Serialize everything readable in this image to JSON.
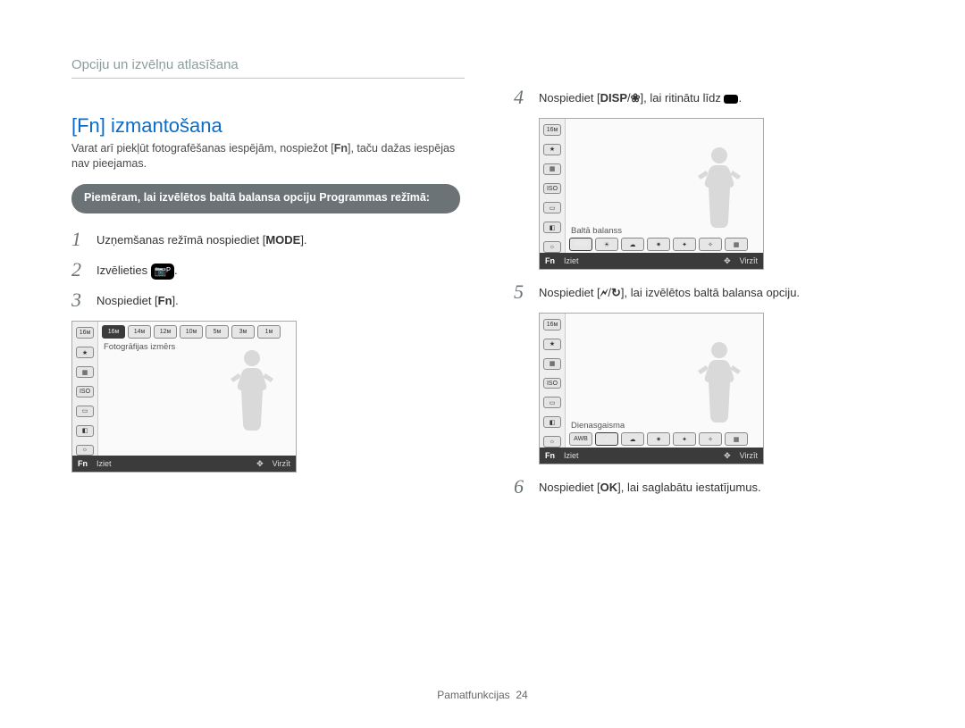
{
  "breadcrumb": "Opciju un izvēlņu atlasīšana",
  "heading": "[Fn] izmantošana",
  "intro_a": "Varat arī piekļūt fotografēšanas iespējām, nospiežot [",
  "intro_b": "], taču dažas iespējas nav pieejamas.",
  "intro_fn": "Fn",
  "pill": "Piemēram, lai izvēlētos baltā balansa opciju Programmas režīmā:",
  "steps": {
    "1": {
      "n": "1",
      "a": "Uzņemšanas režīmā nospiediet [",
      "key": "MODE",
      "b": "]."
    },
    "2": {
      "n": "2",
      "a": "Izvēlieties ",
      "b": "."
    },
    "3": {
      "n": "3",
      "a": "Nospiediet [",
      "key": "Fn",
      "b": "]."
    },
    "4": {
      "n": "4",
      "a": "Nospiediet [",
      "k1": "DISP",
      "sep": "/",
      "k2": "❀",
      "b": "], lai ritinātu līdz ",
      "c": "."
    },
    "5": {
      "n": "5",
      "a": "Nospiediet [",
      "k1": "🗲",
      "sep": "/",
      "k2": "↻",
      "b": "], lai izvēlētos baltā balansa opciju."
    },
    "6": {
      "n": "6",
      "a": "Nospiediet [",
      "key": "OK",
      "b": "], lai saglabātu iestatījumus."
    }
  },
  "lcd1": {
    "label": "Fotogrāfijas izmērs",
    "chips": [
      "16м",
      "14м",
      "12м",
      "10м",
      "5м",
      "3м",
      "1м"
    ],
    "fn": "Fn",
    "exit": "Iziet",
    "nav": "Virzīt"
  },
  "lcd2": {
    "label": "Baltā balanss",
    "fn": "Fn",
    "exit": "Iziet",
    "nav": "Virzīt"
  },
  "lcd3": {
    "label": "Dienasgaisma",
    "fn": "Fn",
    "exit": "Iziet",
    "nav": "Virzīt"
  },
  "footer": {
    "section": "Pamatfunkcijas",
    "page": "24"
  },
  "icons": {
    "camera_p": "📷ᴾ",
    "awb": "AWB"
  }
}
